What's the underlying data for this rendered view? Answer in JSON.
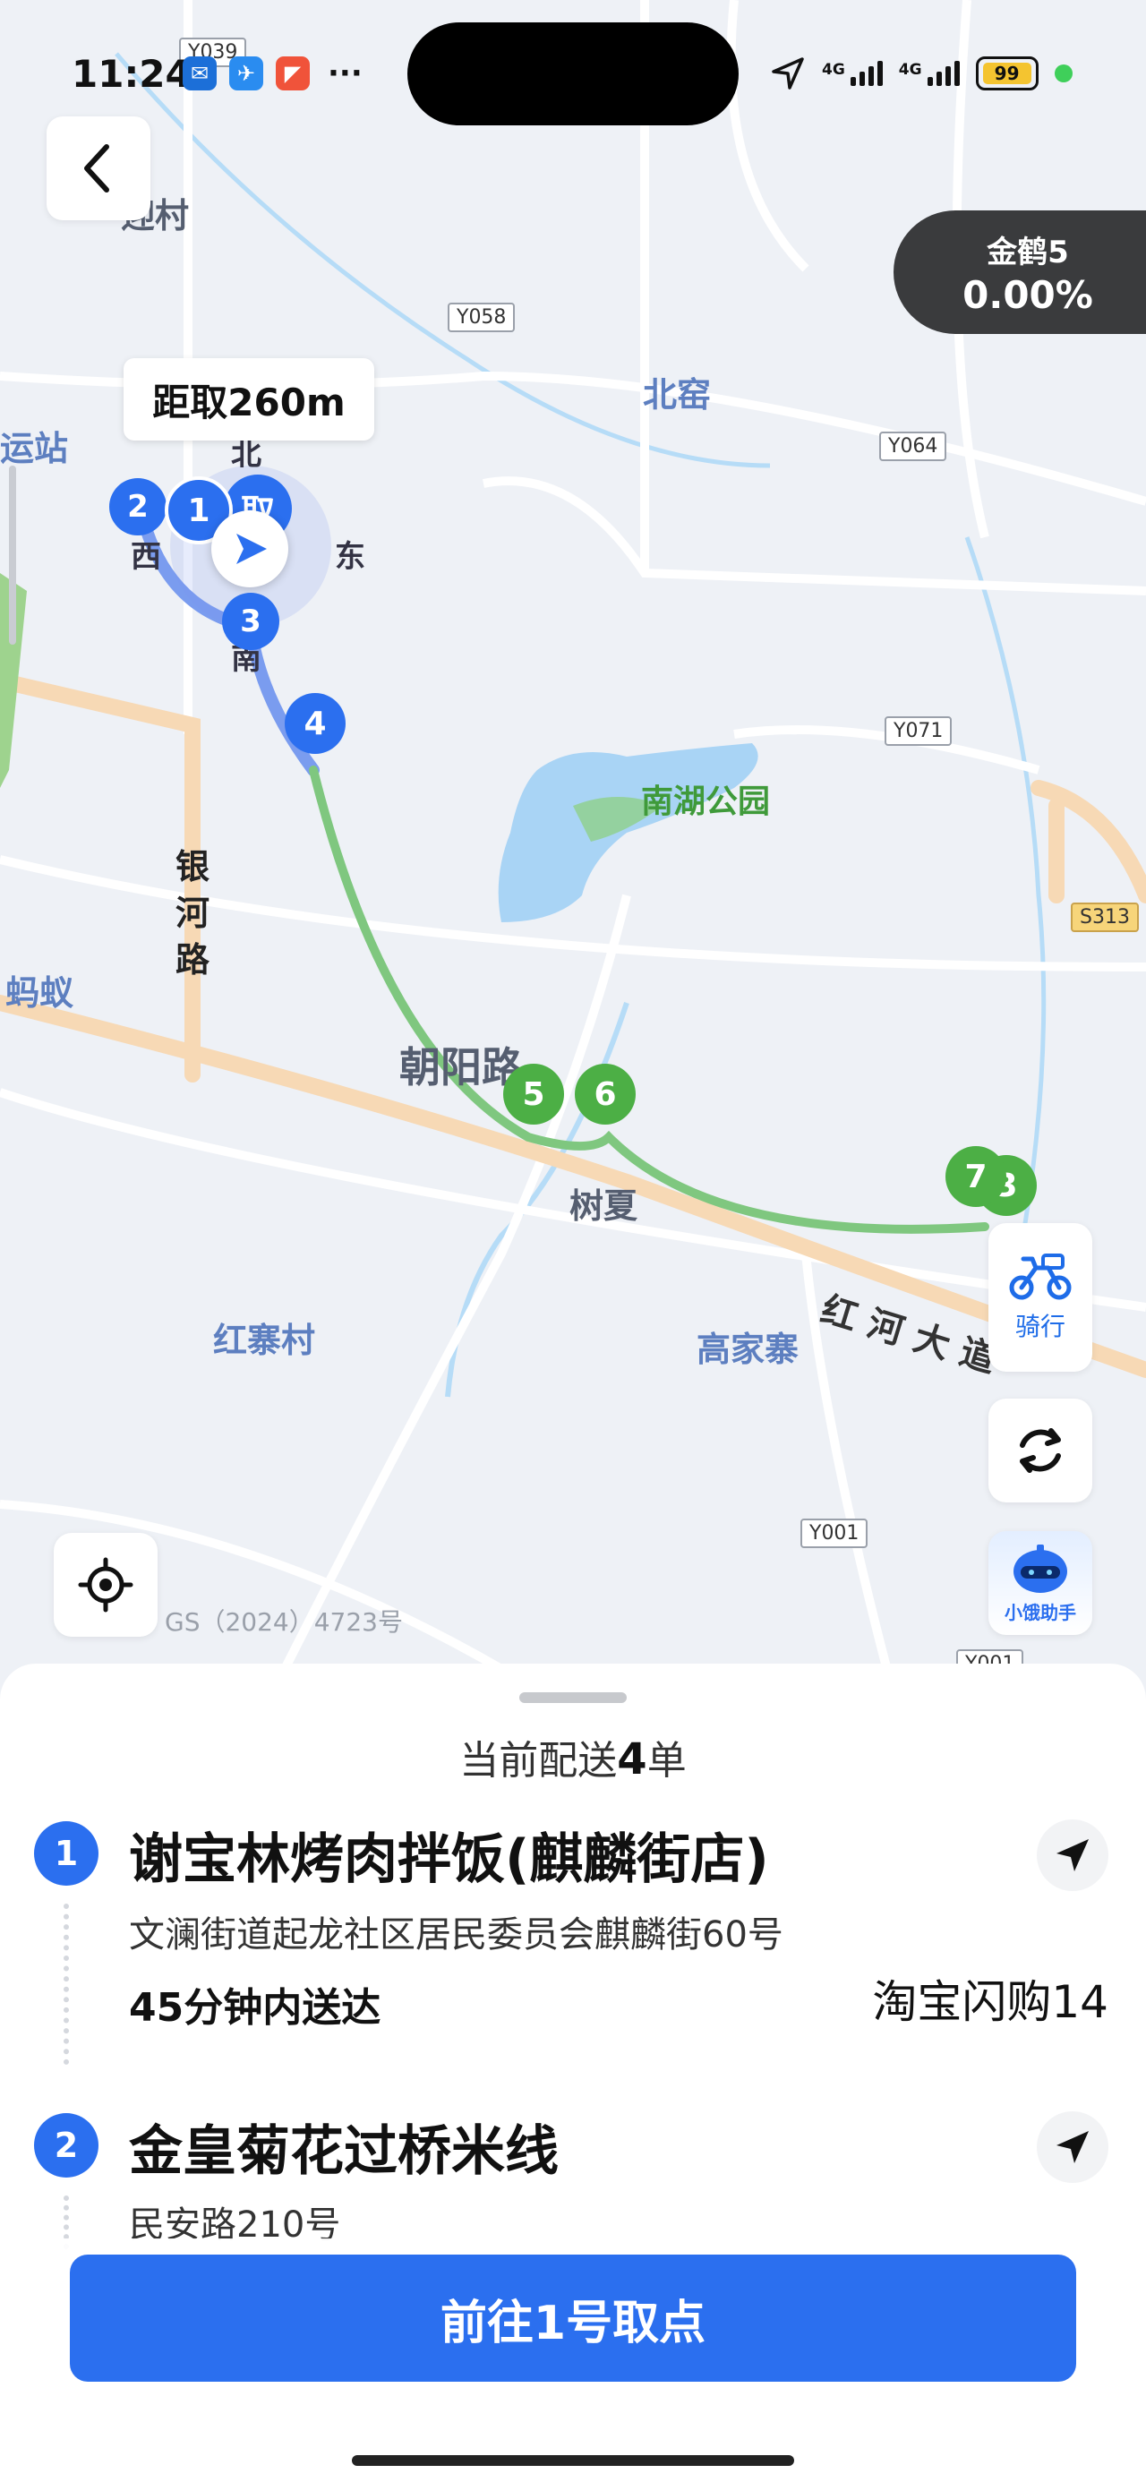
{
  "status_bar": {
    "time": "11:24",
    "dots": "···",
    "net1": "4G",
    "net2": "4G",
    "battery": "99"
  },
  "map": {
    "labels": {
      "village_ying": "迎村",
      "station": "运站",
      "beiyao": "北窑",
      "lake": "南湖公园",
      "yinhe": "银\n河\n路",
      "mayi": "蚂蚁",
      "chaoyang": "朝阳路",
      "shuxia": "树夏",
      "hongzhai": "红寨村",
      "gaojia": "高家寨",
      "honghe": "红 河 大 道",
      "dir_n": "北",
      "dir_s": "南",
      "dir_w": "西",
      "dir_e": "东",
      "pickup": "取"
    },
    "road_signs": [
      "Y039",
      "Y058",
      "Y064",
      "Y071",
      "S313",
      "Y001",
      "Y001"
    ],
    "markers": [
      "1",
      "2",
      "3",
      "4",
      "5",
      "6",
      "7",
      "3"
    ],
    "distance": "距取260m",
    "gs": "GS（2024）4723号"
  },
  "rating": {
    "name": "金鹤5",
    "value": "0.00%"
  },
  "controls": {
    "ride_label": "骑行",
    "assistant_label": "小饿助手"
  },
  "sheet": {
    "title_prefix": "当前配送",
    "title_count": "4",
    "title_suffix": "单",
    "orders": [
      {
        "num": "1",
        "name": "谢宝林烤肉拌饭(麒麟街店)",
        "address": "文澜街道起龙社区居民委员会麒麟街60号",
        "time": "45分钟内送达",
        "platform": "淘宝闪购14"
      },
      {
        "num": "2",
        "name": "金皇菊花过桥米线",
        "address": "民安路210号"
      }
    ],
    "cta": "前往1号取点"
  }
}
